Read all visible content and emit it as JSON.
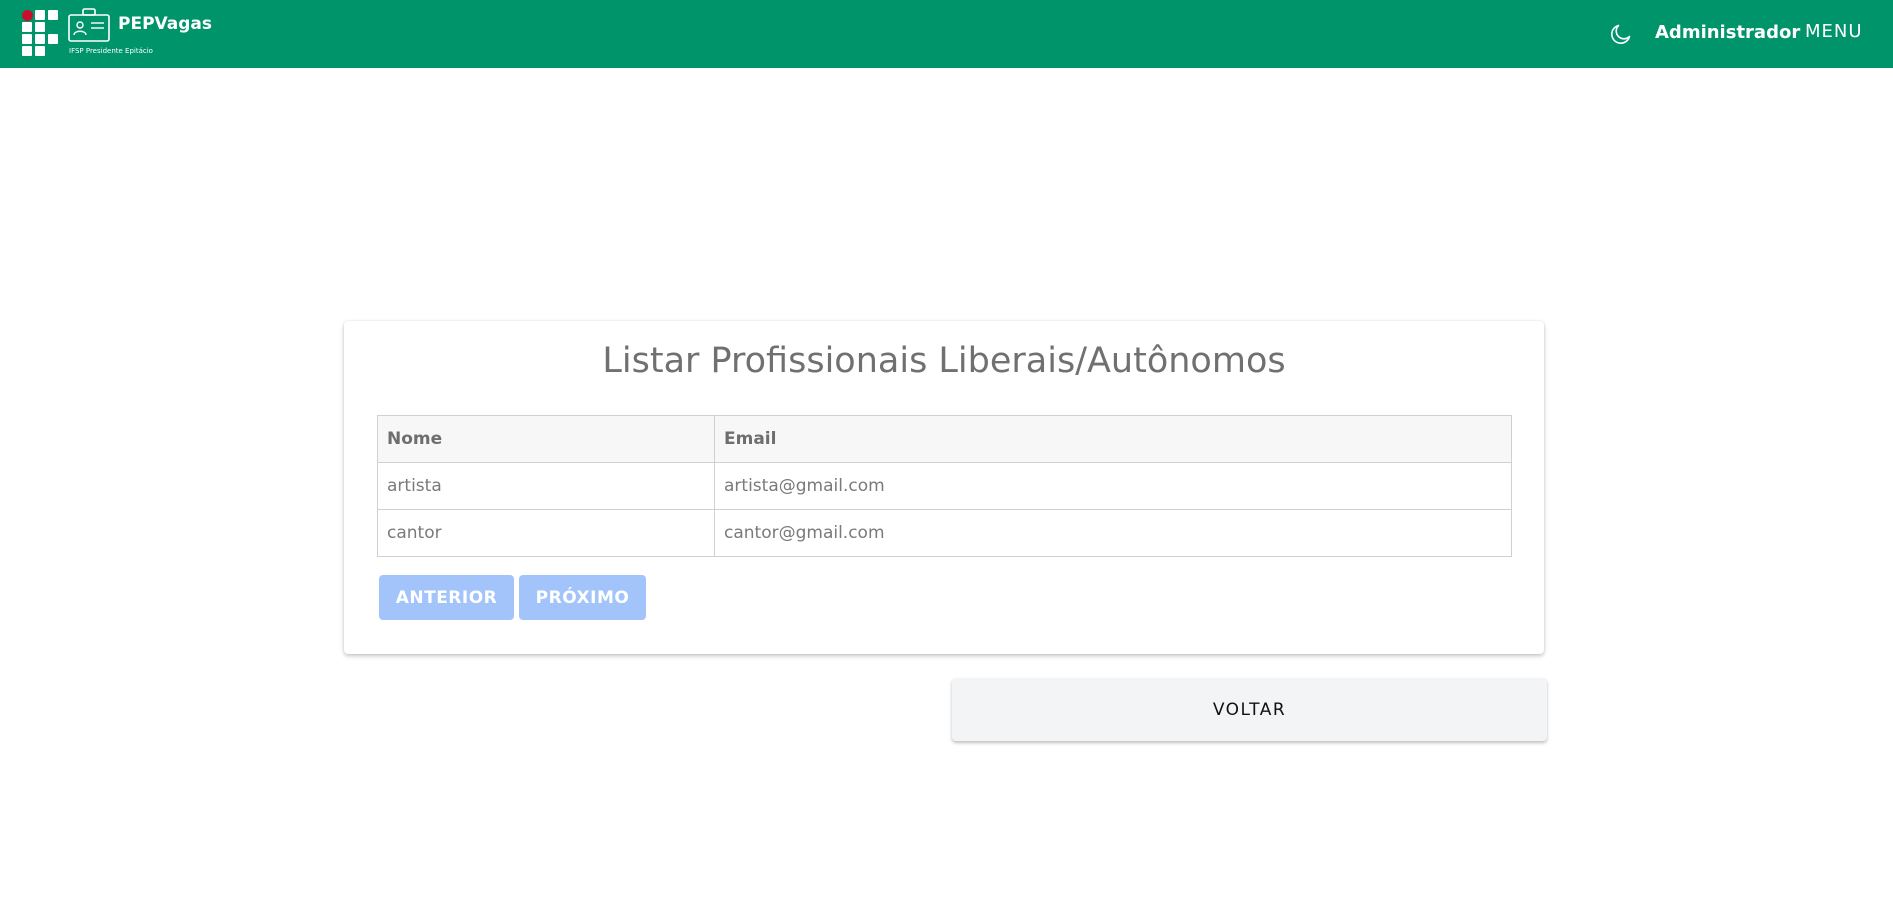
{
  "navbar": {
    "brand_title": "PEPVagas",
    "brand_subtitle": "IFSP Presidente Epitácio",
    "user_label": "Administrador",
    "menu_label": "MENU",
    "theme_icon": "moon-icon",
    "background_color": "#00946b"
  },
  "main": {
    "title": "Listar Profissionais Liberais/Autônomos",
    "table": {
      "headers": [
        "Nome",
        "Email"
      ],
      "rows": [
        {
          "nome": "artista",
          "email": "artista@gmail.com"
        },
        {
          "nome": "cantor",
          "email": "cantor@gmail.com"
        }
      ]
    },
    "pagination": {
      "prev_label": "ANTERIOR",
      "next_label": "PRÓXIMO",
      "button_color": "#a3c4fb"
    }
  },
  "back_button": {
    "label": "VOLTAR"
  }
}
